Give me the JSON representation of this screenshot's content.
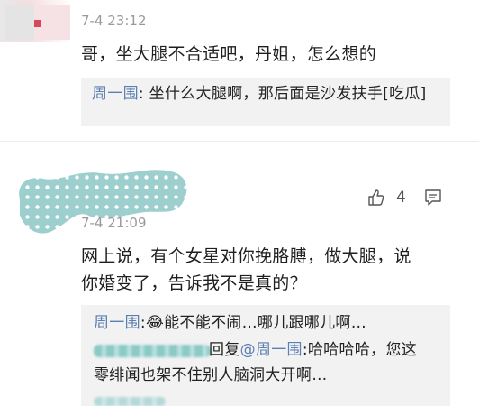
{
  "comments": [
    {
      "timestamp": "7-4 23:12",
      "text": "哥，坐大腿不合适吧，丹姐，怎么想的",
      "reply": {
        "user": "周一围",
        "text": ": 坐什么大腿啊，那后面是沙发扶手[吃瓜]"
      }
    },
    {
      "timestamp": "7-4 21:09",
      "like_count": "4",
      "like_icon": "thumbs-up-icon",
      "comment_icon": "comment-icon",
      "text_line1": "网上说，有个女星对你挽胳膊，做大腿，说",
      "text_line2": "你婚变了，告诉我不是真的？",
      "replies": [
        {
          "user": "周一围",
          "sep": ":",
          "emoji": "😂",
          "text": "能不能不闹…哪儿跟哪儿啊…"
        },
        {
          "prefix": "回复",
          "mention": "@周一围",
          "text_line1": ":哈哈哈哈，您这",
          "text_line2": "零绯闻也架不住别人脑洞大开啊…"
        }
      ]
    }
  ]
}
